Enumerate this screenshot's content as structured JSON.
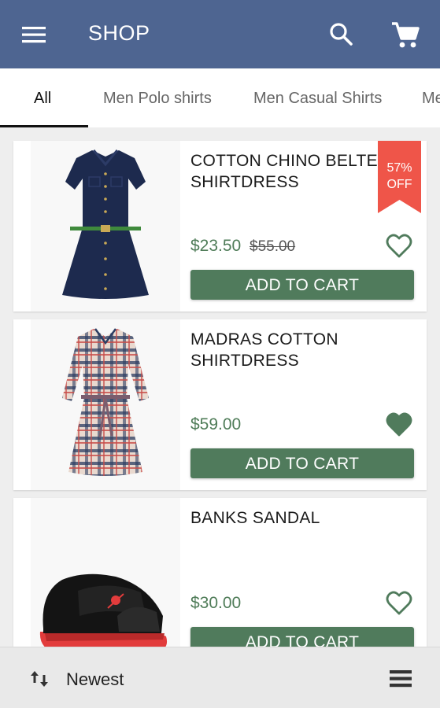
{
  "appbar": {
    "title": "SHOP",
    "icons": [
      "menu-icon",
      "search-icon",
      "cart-icon"
    ],
    "color": "#4e6591"
  },
  "tabs": [
    {
      "label": "All",
      "active": true
    },
    {
      "label": "Men Polo shirts",
      "active": false
    },
    {
      "label": "Men Casual Shirts",
      "active": false
    },
    {
      "label": "Me",
      "active": false
    }
  ],
  "products": [
    {
      "name": "COTTON CHINO BELTE SHIRTDRESS",
      "price": "$23.50",
      "old_price": "$55.00",
      "badge": {
        "percent": "57%",
        "label": "OFF"
      },
      "favorite": false,
      "image": "navy-shirtdress",
      "button": "ADD TO CART"
    },
    {
      "name": "MADRAS COTTON SHIRTDRESS",
      "price": "$59.00",
      "favorite": true,
      "image": "plaid-shirtdress",
      "button": "ADD TO CART"
    },
    {
      "name": "BANKS SANDAL",
      "price": "$30.00",
      "favorite": false,
      "image": "black-red-sandal",
      "button": "ADD TO CART"
    }
  ],
  "bottombar": {
    "sort_label": "Newest",
    "icons": [
      "sort-icon",
      "list-view-icon"
    ]
  },
  "colors": {
    "accent_green": "#507b5c",
    "price_green": "#4f7c58",
    "badge_red": "#ef5549",
    "primary": "#4e6591"
  }
}
